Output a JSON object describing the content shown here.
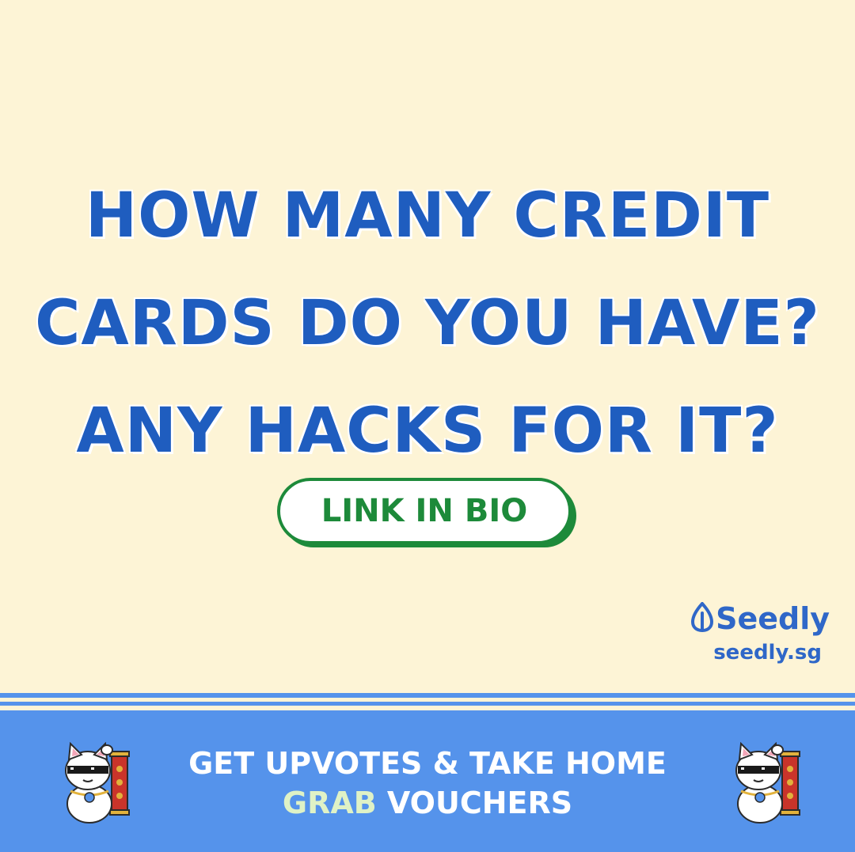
{
  "headline": {
    "line1": "HOW MANY CREDIT",
    "line2": "CARDS DO YOU HAVE?",
    "line3": "ANY HACKS FOR IT?"
  },
  "cta": {
    "label": "LINK IN BIO"
  },
  "brand": {
    "name": "Seedly",
    "url": "seedly.sg"
  },
  "footer": {
    "line1": "GET UPVOTES & TAKE HOME",
    "highlight": "GRAB",
    "line2_rest": " VOUCHERS"
  },
  "icons": [
    "seedly-leaf-icon",
    "lucky-cat-icon"
  ],
  "colors": {
    "background": "#fdf4d6",
    "headline": "#1f5dbf",
    "cta_green": "#1d8a3a",
    "footer_blue": "#5593eb",
    "brand_blue": "#2f67c8"
  }
}
